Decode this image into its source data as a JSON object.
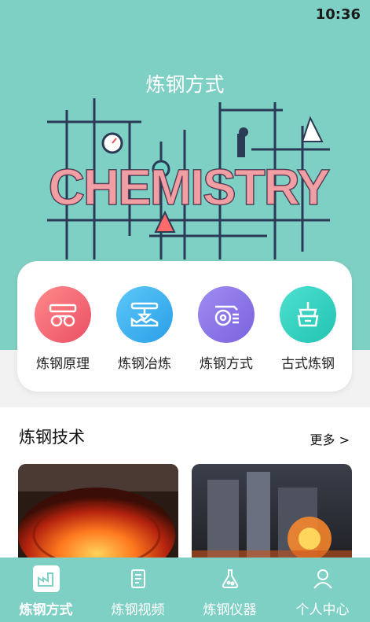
{
  "status_bar": {
    "time": "10:36"
  },
  "header": {
    "title": "炼钢方式"
  },
  "banner": {
    "word": "CHEMISTRY"
  },
  "menu": {
    "items": [
      {
        "label": "炼钢原理",
        "icon": "factory-conveyor-icon",
        "color": "#f06a74"
      },
      {
        "label": "炼钢冶炼",
        "icon": "crane-factory-icon",
        "color": "#3fb3f0"
      },
      {
        "label": "炼钢方式",
        "icon": "conveyor-belt-icon",
        "color": "#8d78e8"
      },
      {
        "label": "古式炼钢",
        "icon": "ancient-furnace-icon",
        "color": "#36d1c0"
      }
    ]
  },
  "section": {
    "title": "炼钢技术",
    "more_label": "更多 >"
  },
  "bottom_nav": {
    "items": [
      {
        "label": "炼钢方式",
        "icon": "factory-icon",
        "active": true
      },
      {
        "label": "炼钢视频",
        "icon": "video-doc-icon",
        "active": false
      },
      {
        "label": "炼钢仪器",
        "icon": "flask-icon",
        "active": false
      },
      {
        "label": "个人中心",
        "icon": "person-icon",
        "active": false
      }
    ]
  },
  "colors": {
    "teal": "#7fd0c4",
    "background": "#f2f2f2"
  }
}
